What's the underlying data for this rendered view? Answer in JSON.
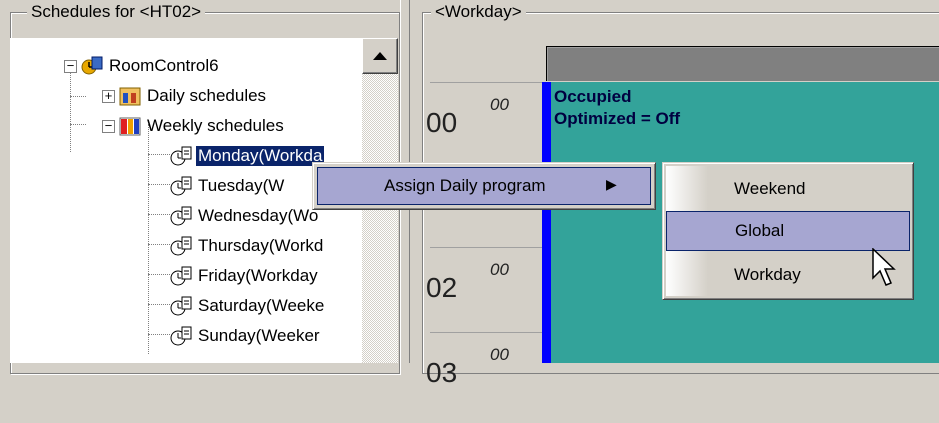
{
  "left_panel": {
    "title": "Schedules for  <HT02>",
    "tree": [
      {
        "label": "RoomControl6",
        "icon": "room-control-icon",
        "expander": "−"
      },
      {
        "label": "Daily schedules",
        "icon": "daily-schedules-icon",
        "expander": "+"
      },
      {
        "label": "Weekly schedules",
        "icon": "weekly-schedules-icon",
        "expander": "−"
      },
      {
        "label": "Monday(Workda",
        "icon": "clock-icon",
        "selected": true
      },
      {
        "label": "Tuesday(W",
        "icon": "clock-icon"
      },
      {
        "label": "Wednesday(Wo",
        "icon": "clock-icon"
      },
      {
        "label": "Thursday(Workd",
        "icon": "clock-icon"
      },
      {
        "label": "Friday(Workday",
        "icon": "clock-icon"
      },
      {
        "label": "Saturday(Weeke",
        "icon": "clock-icon"
      },
      {
        "label": "Sunday(Weeker",
        "icon": "clock-icon"
      }
    ]
  },
  "right_panel": {
    "title": "<Workday>",
    "times": [
      {
        "hh": "00",
        "mm": "00"
      },
      {
        "hh": "02",
        "mm": "00"
      },
      {
        "hh": "03",
        "mm": "00"
      }
    ],
    "block_text": [
      "Occupied",
      "Optimized = Off"
    ],
    "block_color": "#33a39a"
  },
  "context_menu": {
    "item": "Assign Daily program",
    "arrow": "▶"
  },
  "submenu": {
    "items": [
      "Weekend",
      "Global",
      "Workday"
    ],
    "hovered": "Global"
  },
  "colors": {
    "selection": "#0a246a",
    "menu_highlight": "#a6a6d1",
    "edge_blue": "#0000ff"
  }
}
